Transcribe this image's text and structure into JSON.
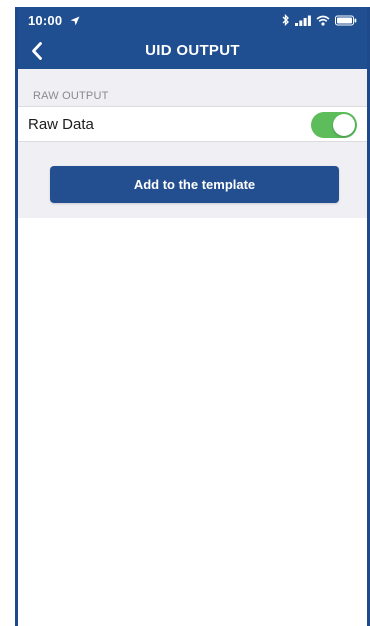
{
  "status_bar": {
    "time": "10:00",
    "icons": [
      "location-arrow-icon",
      "bluetooth-icon",
      "signal-icon",
      "wifi-icon",
      "battery-icon"
    ]
  },
  "nav": {
    "title": "UID OUTPUT",
    "back_icon": "chevron-left-icon"
  },
  "section": {
    "header": "RAW OUTPUT"
  },
  "rows": [
    {
      "label": "Raw Data",
      "toggle_on": true
    }
  ],
  "actions": {
    "add_label": "Add to the template"
  },
  "colors": {
    "nav_background": "#1f4e91",
    "toggle_on": "#5cbd5a",
    "button_background": "#234f90",
    "content_background": "#efeff4"
  }
}
